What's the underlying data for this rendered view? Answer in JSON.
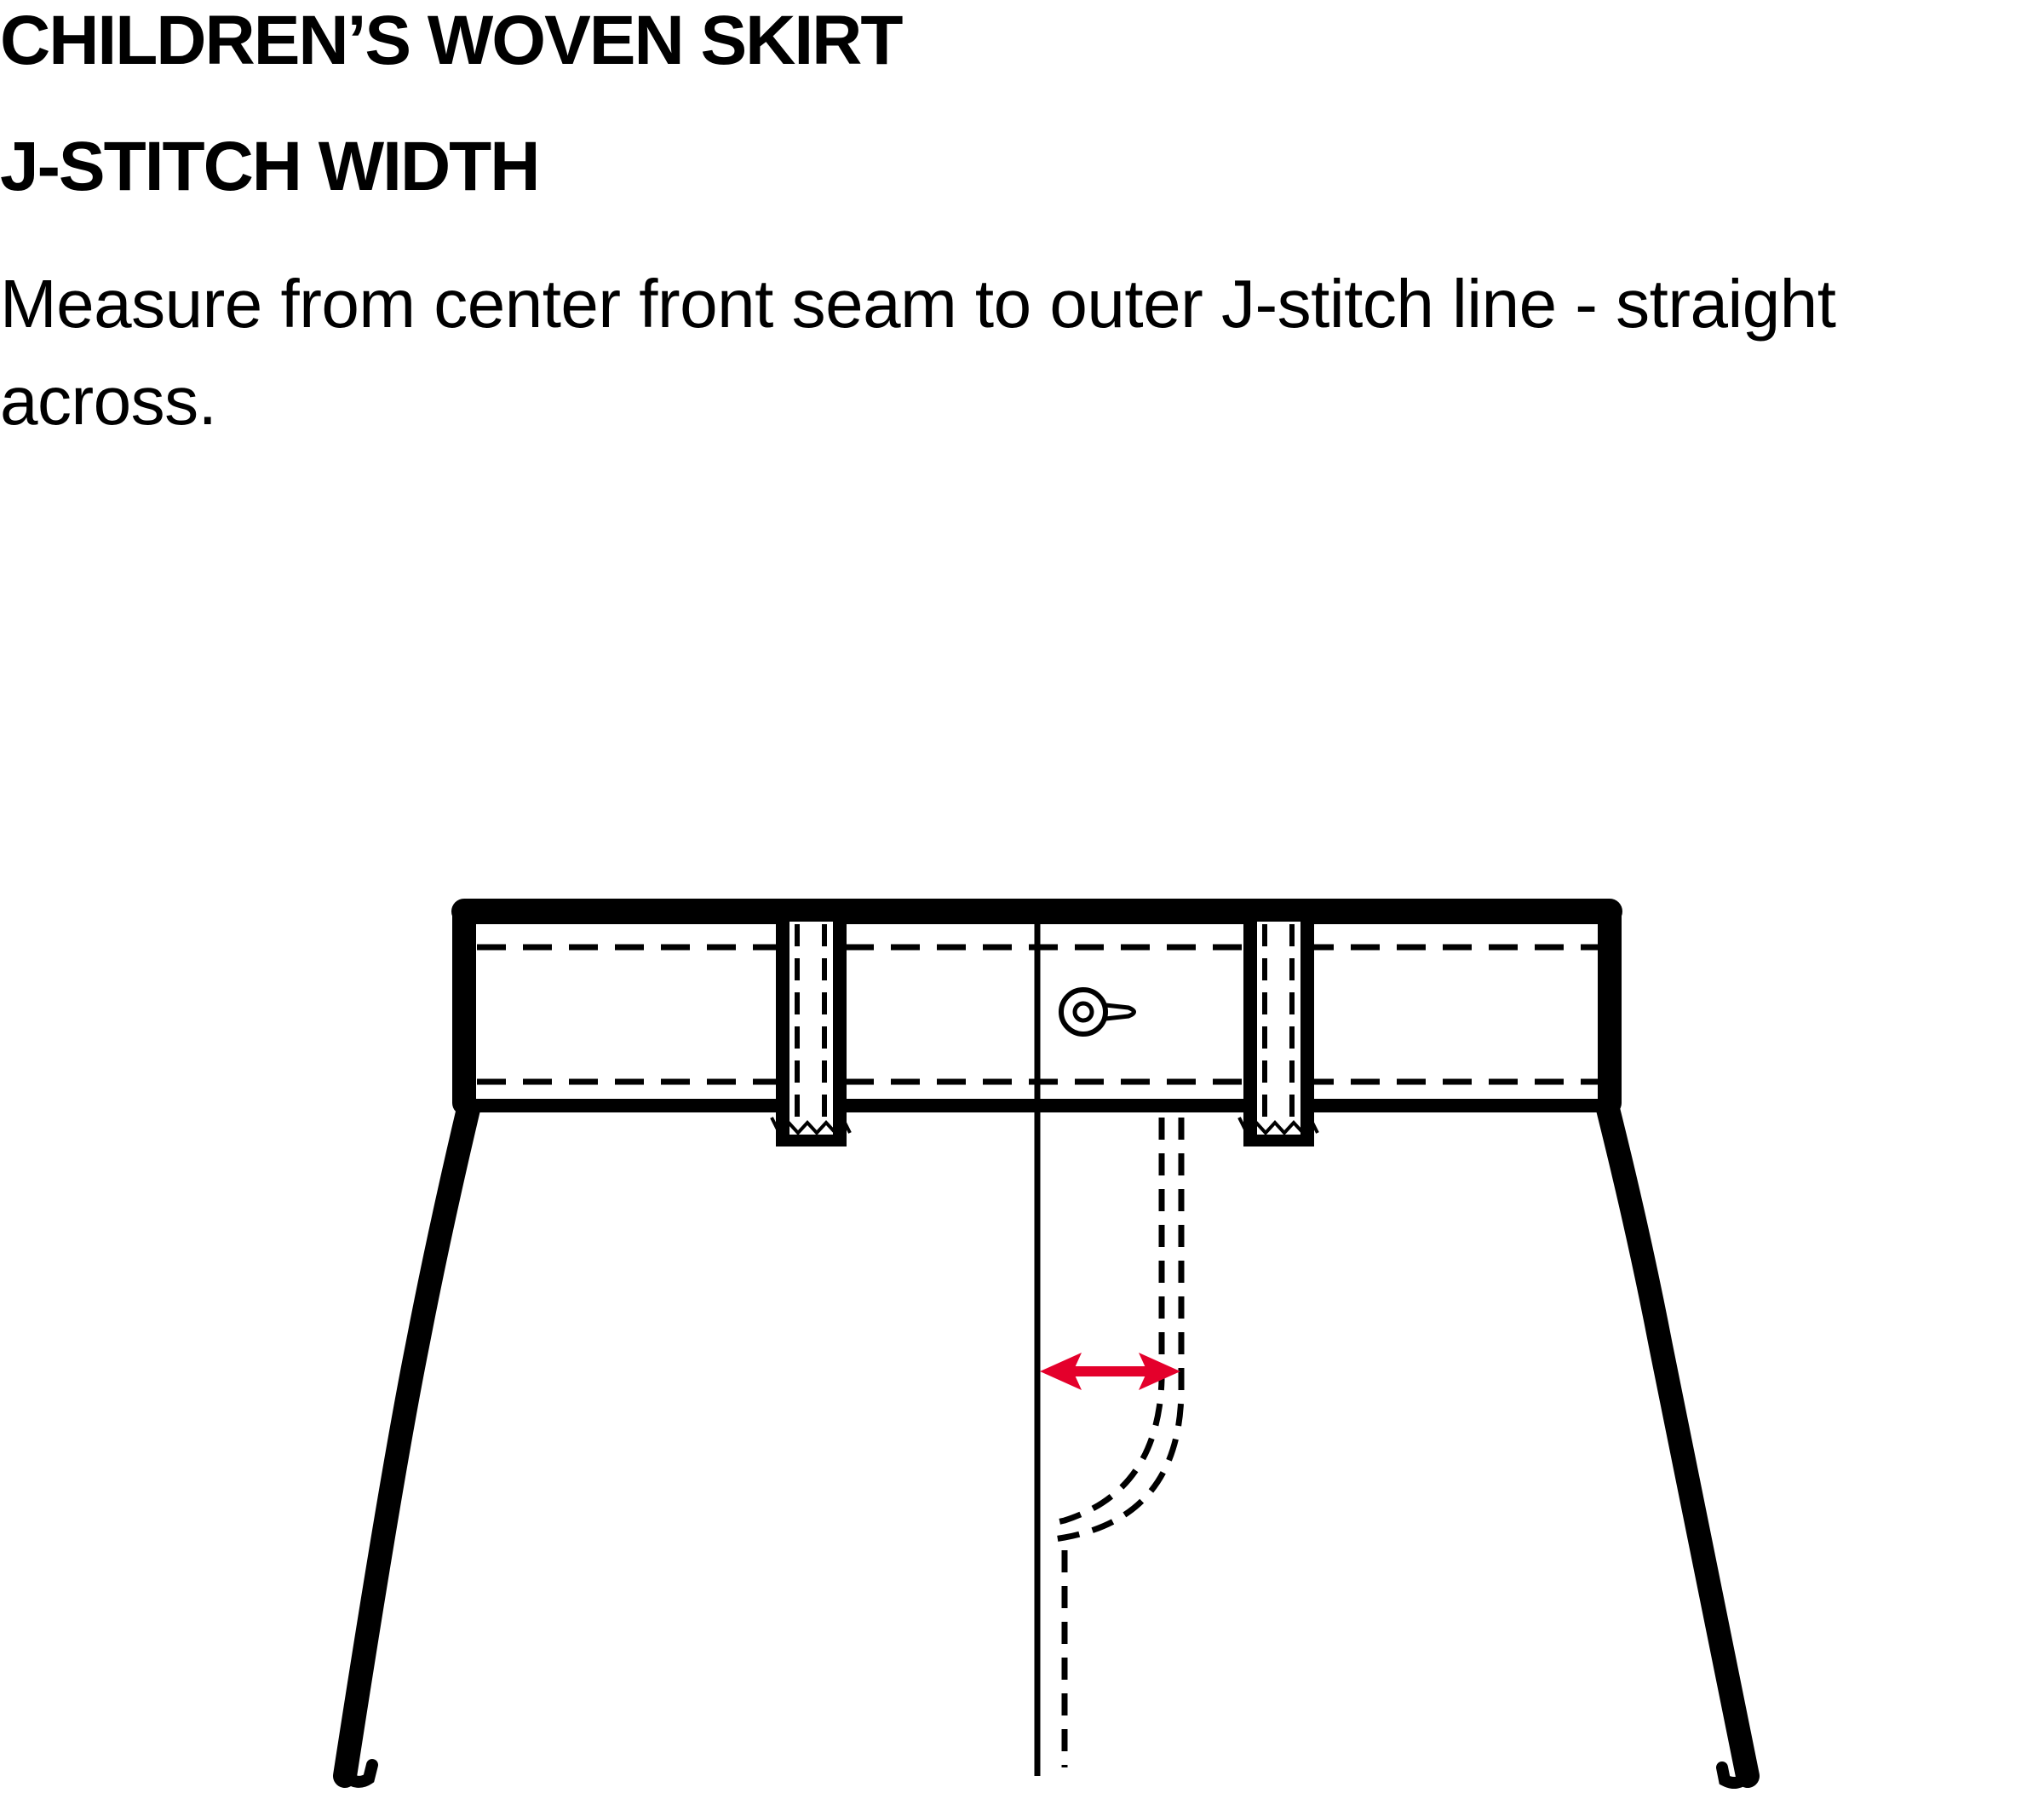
{
  "header": {
    "title": "CHILDREN’S WOVEN SKIRT",
    "subtitle": "J-STITCH WIDTH"
  },
  "instruction": {
    "text": "Measure from center front seam to outer J-stitch line - straight across."
  },
  "colors": {
    "measure_arrow": "#e4002b",
    "outline": "#000000",
    "background": "#ffffff"
  },
  "diagram": {
    "garment": "skirt-front",
    "icons": [
      "button-icon",
      "belt-loop-left",
      "belt-loop-right",
      "measurement-arrow"
    ]
  }
}
